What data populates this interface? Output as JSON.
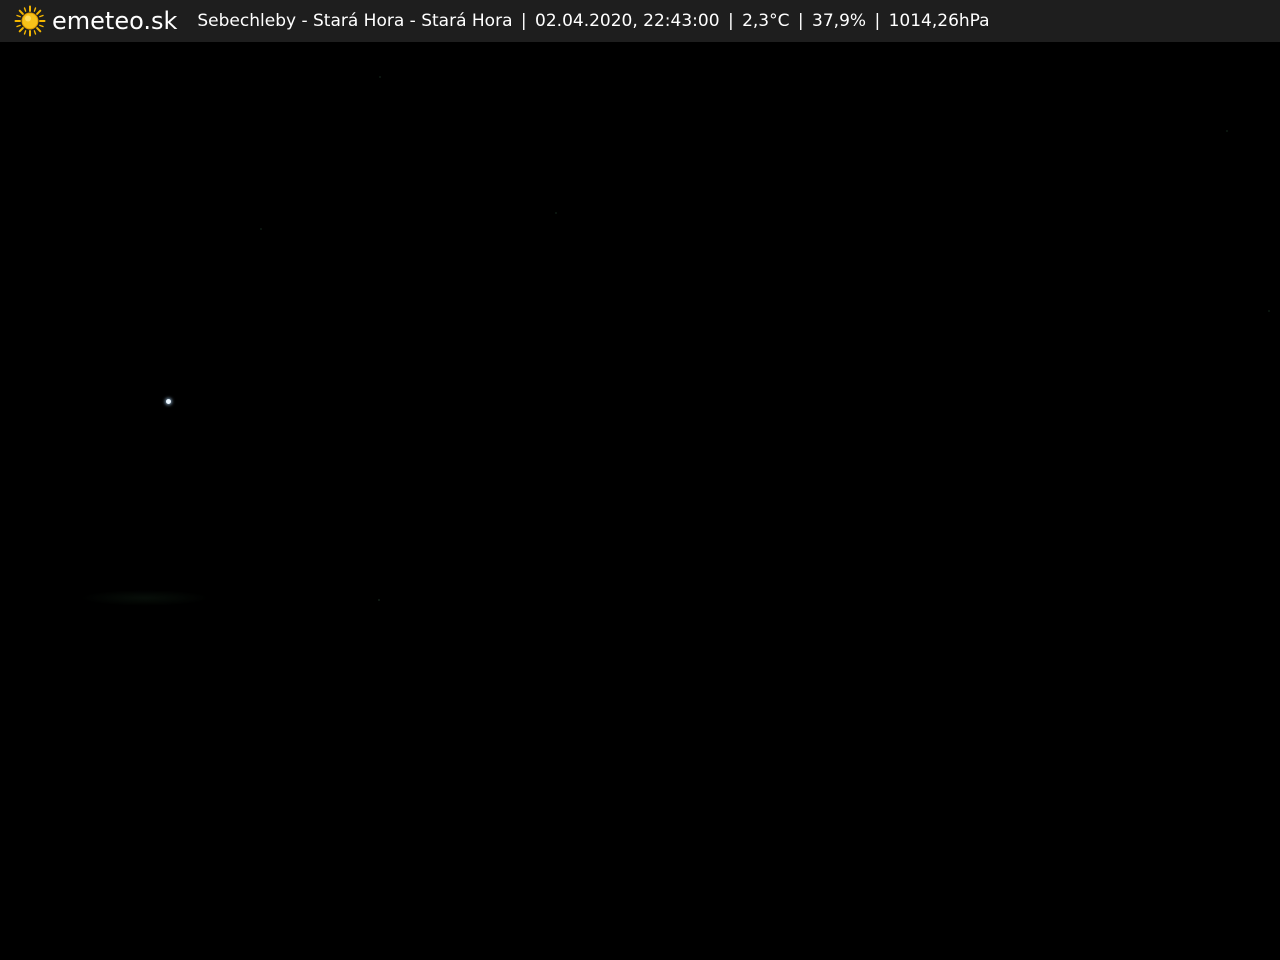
{
  "header": {
    "brand": "emeteo.sk",
    "logo_icon": "sun-icon",
    "location": "Sebechleby - Stará Hora - Stará Hora",
    "datetime": "02.04.2020, 22:43:00",
    "temperature": "2,3°C",
    "humidity": "37,9%",
    "pressure": "1014,26hPa",
    "separator": "|"
  },
  "colors": {
    "bar_background": "#1e1e1e",
    "text": "#ffffff",
    "sun_yellow": "#f5b800",
    "sky": "#000000"
  },
  "scene": {
    "description_icon": "night-sky-webcam-image"
  }
}
